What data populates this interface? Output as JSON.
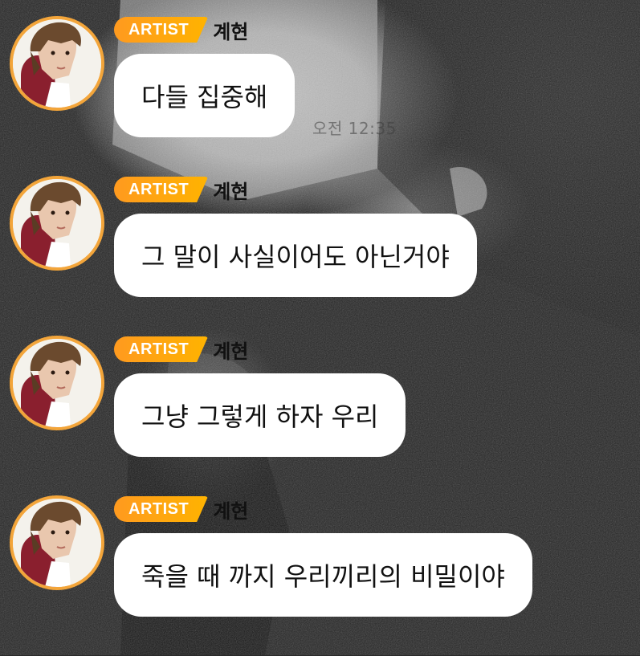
{
  "chat": {
    "timestamp": "오전 12:35",
    "messages": [
      {
        "badge": "ARTIST",
        "name": "계현",
        "text": "다들 집중해"
      },
      {
        "badge": "ARTIST",
        "name": "계현",
        "text": "그 말이 사실이어도 아닌거야"
      },
      {
        "badge": "ARTIST",
        "name": "계현",
        "text": "그냥 그렇게 하자 우리"
      },
      {
        "badge": "ARTIST",
        "name": "계현",
        "text": "죽을 때 까지 우리끼리의 비밀이야"
      }
    ]
  },
  "colors": {
    "badge_start": "#ff9a1f",
    "badge_end": "#ffb300",
    "avatar_ring": "#f3a53a",
    "bubble": "#ffffff"
  }
}
